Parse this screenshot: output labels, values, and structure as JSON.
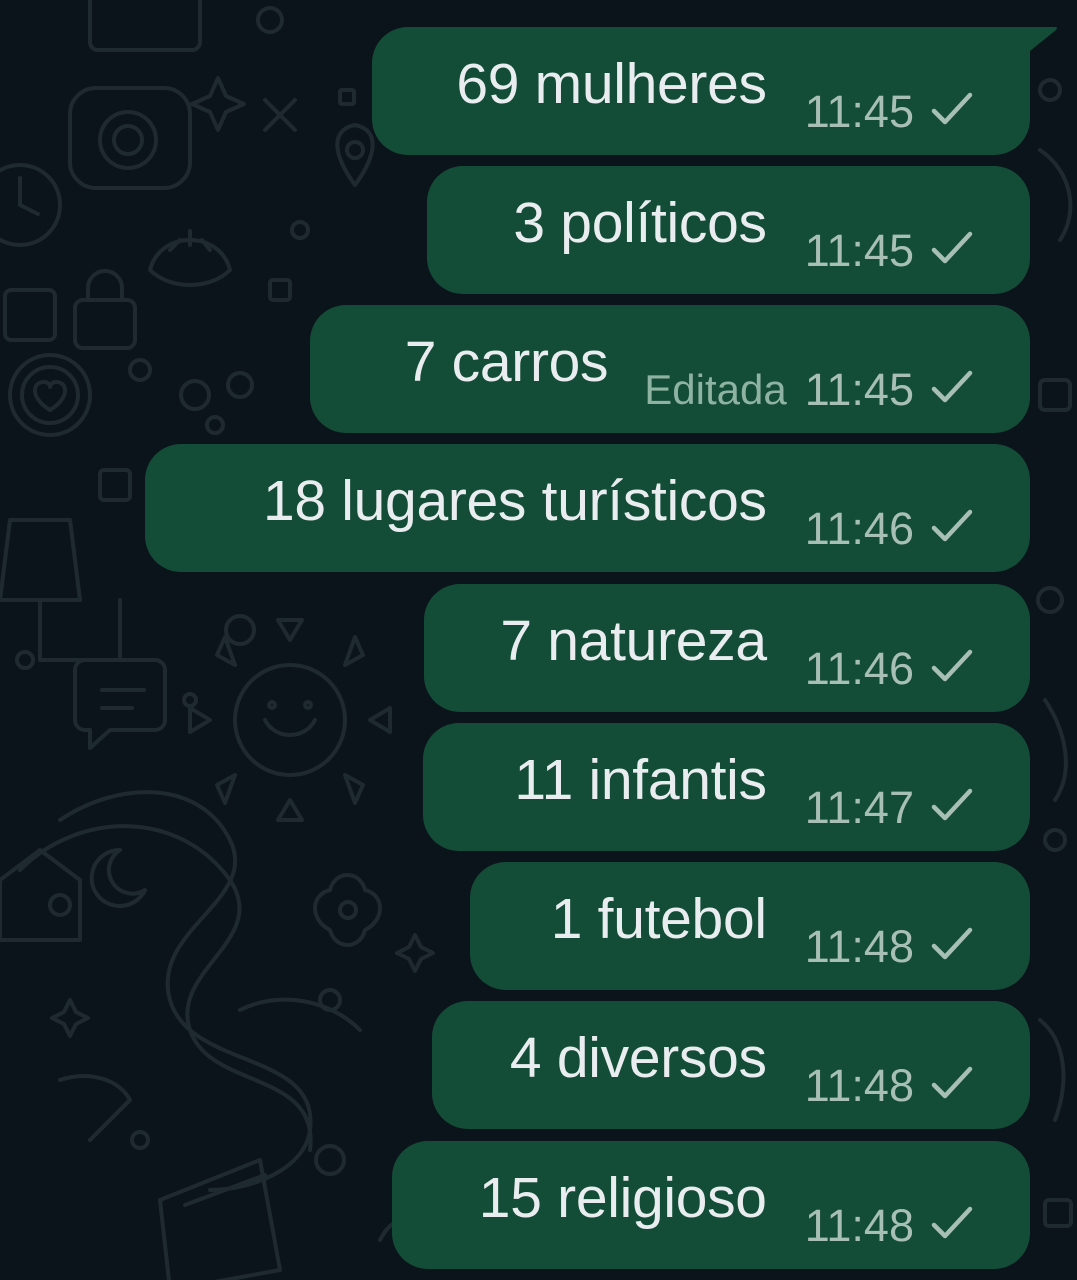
{
  "theme": {
    "background": "#0b141a",
    "bubble_color": "#144d37",
    "text_color": "#e9edef",
    "meta_color": "#a7bfb4",
    "check_icon": "single-check-icon"
  },
  "messages": [
    {
      "text": "69 mulheres",
      "edited": "",
      "time": "11:45"
    },
    {
      "text": "3 políticos",
      "edited": "",
      "time": "11:45"
    },
    {
      "text": "7 carros",
      "edited": "Editada",
      "time": "11:45"
    },
    {
      "text": "18 lugares turísticos",
      "edited": "",
      "time": "11:46"
    },
    {
      "text": "7 natureza",
      "edited": "",
      "time": "11:46"
    },
    {
      "text": "11 infantis",
      "edited": "",
      "time": "11:47"
    },
    {
      "text": "1 futebol",
      "edited": "",
      "time": "11:48"
    },
    {
      "text": "4 diversos",
      "edited": "",
      "time": "11:48"
    },
    {
      "text": "15 religioso",
      "edited": "",
      "time": "11:48"
    }
  ]
}
